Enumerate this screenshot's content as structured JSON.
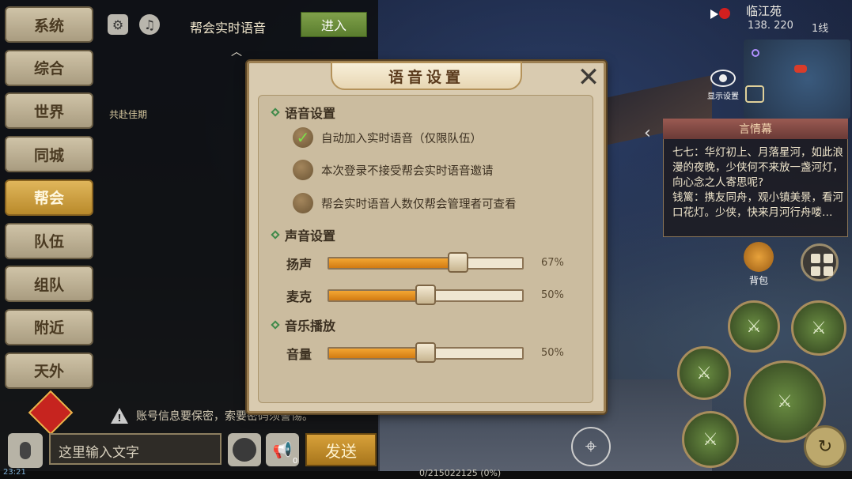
{
  "chat_tabs": [
    "系统",
    "综合",
    "世界",
    "同城",
    "帮会",
    "队伍",
    "组队",
    "附近",
    "天外"
  ],
  "active_tab": "帮会",
  "top_bar": {
    "voice_title": "帮会实时语音",
    "enter_label": "进入"
  },
  "chat": {
    "lantern_text": "共赴佳期",
    "warning_text": "账号信息要保密，索要密码须警惕。",
    "input_placeholder": "这里输入文字",
    "send_label": "发送",
    "horn_count": "0",
    "clock": "23:21"
  },
  "status": {
    "exp_text": "0/215022125 (0%)"
  },
  "map": {
    "location": "临江苑",
    "coords": "138. 220",
    "line": "1线",
    "display_label": "显示设置"
  },
  "notice": {
    "title": "言情幕",
    "text": "七七：华灯初上、月落星河，如此浪漫的夜晚，少侠何不来放一盏河灯，向心念之人寄思呢?\n钱篱：携友同舟，观小镇美景，看河口花灯。少侠，快来月河行舟喽…"
  },
  "hud": {
    "bag_label": "背包"
  },
  "dialog": {
    "title": "语音设置",
    "voice_section": "语音设置",
    "options": [
      {
        "label": "自动加入实时语音（仅限队伍）",
        "checked": true
      },
      {
        "label": "本次登录不接受帮会实时语音邀请",
        "checked": false
      },
      {
        "label": "帮会实时语音人数仅帮会管理者可查看",
        "checked": false
      }
    ],
    "sound_section": "声音设置",
    "speaker": {
      "label": "扬声",
      "value": 67,
      "text": "67%"
    },
    "mic": {
      "label": "麦克",
      "value": 50,
      "text": "50%"
    },
    "music_section": "音乐播放",
    "volume": {
      "label": "音量",
      "value": 50,
      "text": "50%"
    }
  },
  "colors": {
    "accent_gold": "#d8a13a",
    "slider_fill": "#f3a633",
    "check_green": "#7ddf4a"
  },
  "icons": [
    "settings-gear-icon",
    "music-note-icon",
    "microphone-icon",
    "emoji-icon",
    "horn-icon",
    "close-icon",
    "eye-icon",
    "camera-icon",
    "target-icon",
    "switch-icon"
  ]
}
